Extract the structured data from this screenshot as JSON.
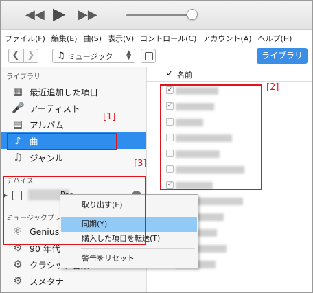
{
  "player": {
    "rewind_icon": "rewind-icon",
    "play_icon": "play-icon",
    "forward_icon": "fast-forward-icon"
  },
  "menubar": [
    "ファイル(F)",
    "編集(E)",
    "曲(S)",
    "表示(V)",
    "コントロール(C)",
    "アカウント(A)",
    "ヘルプ(H)"
  ],
  "toolbar": {
    "media_type": "ミュージック",
    "library_button": "ライブラリ"
  },
  "sidebar": {
    "library_header": "ライブラリ",
    "items": [
      {
        "label": "最近追加した項目",
        "icon": "grid-icon"
      },
      {
        "label": "アーティスト",
        "icon": "microphone-icon"
      },
      {
        "label": "アルバム",
        "icon": "album-icon"
      },
      {
        "label": "曲",
        "icon": "music-note-icon"
      },
      {
        "label": "ジャンル",
        "icon": "genre-icon"
      }
    ],
    "selected_index": 3,
    "devices_header": "デバイス",
    "device_name_tail": "Pod",
    "playlists_header": "ミュージックプレイ",
    "playlists": [
      {
        "label": "Genius",
        "icon": "atom-icon"
      },
      {
        "label": "90 年代",
        "icon": "gear-icon"
      },
      {
        "label": "クラシック音楽",
        "icon": "gear-icon"
      },
      {
        "label": "スメタナ",
        "icon": "gear-icon"
      }
    ]
  },
  "list": {
    "check_header": "✓",
    "name_header": "名前",
    "rows_checked": [
      true,
      true,
      false,
      false,
      false,
      false,
      true,
      true
    ]
  },
  "context_menu": {
    "items": [
      "取り出す(E)",
      "同期(Y)",
      "購入した項目を転送(T)",
      "警告をリセット"
    ],
    "highlighted_index": 1
  },
  "annotations": {
    "label1": "[1]",
    "label2": "[2]",
    "label3": "[3]"
  },
  "colors": {
    "selection_blue": "#2f8ded",
    "library_button_blue": "#3a8ee6",
    "menu_highlight": "#91c9f7",
    "annotation_red": "#e0151c"
  }
}
